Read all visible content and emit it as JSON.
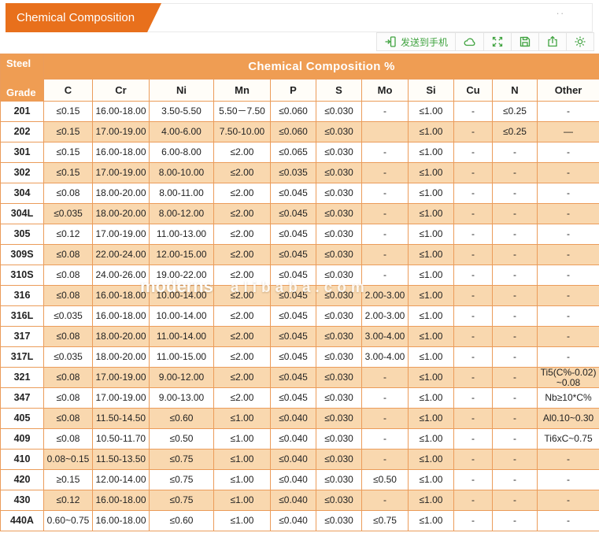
{
  "titlebar": {
    "tab_title": "Chemical Composition",
    "overflow_dots": ".."
  },
  "toolbar": {
    "send_to_phone_label": "发送到手机",
    "icons": [
      "send-to-phone",
      "cloud",
      "fullscreen",
      "save",
      "share",
      "settings"
    ]
  },
  "colors": {
    "tab_orange": "#e8701c",
    "header_orange": "#ef9d53",
    "row_peach": "#f9d8af",
    "border_orange": "#eb9c5a",
    "icon_green": "#3fa33f"
  },
  "watermark": {
    "brand": "moderns",
    "site": "alibaba.com"
  },
  "table": {
    "corner_top": "Steel",
    "corner_bottom": "Grade",
    "header_band": "Chemical Composition %",
    "columns": [
      "C",
      "Cr",
      "Ni",
      "Mn",
      "P",
      "S",
      "Mo",
      "Si",
      "Cu",
      "N",
      "Other"
    ],
    "rows": [
      {
        "grade": "201",
        "values": [
          "≤0.15",
          "16.00-18.00",
          "3.50-5.50",
          "5.50－7.50",
          "≤0.060",
          "≤0.030",
          "-",
          "≤1.00",
          "-",
          "≤0.25",
          "-"
        ]
      },
      {
        "grade": "202",
        "values": [
          "≤0.15",
          "17.00-19.00",
          "4.00-6.00",
          "7.50-10.00",
          "≤0.060",
          "≤0.030",
          "",
          "≤1.00",
          "-",
          "≤0.25",
          "—"
        ]
      },
      {
        "grade": "301",
        "values": [
          "≤0.15",
          "16.00-18.00",
          "6.00-8.00",
          "≤2.00",
          "≤0.065",
          "≤0.030",
          "-",
          "≤1.00",
          "-",
          "-",
          "-"
        ]
      },
      {
        "grade": "302",
        "values": [
          "≤0.15",
          "17.00-19.00",
          "8.00-10.00",
          "≤2.00",
          "≤0.035",
          "≤0.030",
          "-",
          "≤1.00",
          "-",
          "-",
          "-"
        ]
      },
      {
        "grade": "304",
        "values": [
          "≤0.08",
          "18.00-20.00",
          "8.00-11.00",
          "≤2.00",
          "≤0.045",
          "≤0.030",
          "-",
          "≤1.00",
          "-",
          "-",
          "-"
        ]
      },
      {
        "grade": "304L",
        "values": [
          "≤0.035",
          "18.00-20.00",
          "8.00-12.00",
          "≤2.00",
          "≤0.045",
          "≤0.030",
          "-",
          "≤1.00",
          "-",
          "-",
          "-"
        ]
      },
      {
        "grade": "305",
        "values": [
          "≤0.12",
          "17.00-19.00",
          "11.00-13.00",
          "≤2.00",
          "≤0.045",
          "≤0.030",
          "-",
          "≤1.00",
          "-",
          "-",
          "-"
        ]
      },
      {
        "grade": "309S",
        "values": [
          "≤0.08",
          "22.00-24.00",
          "12.00-15.00",
          "≤2.00",
          "≤0.045",
          "≤0.030",
          "-",
          "≤1.00",
          "-",
          "-",
          "-"
        ]
      },
      {
        "grade": "310S",
        "values": [
          "≤0.08",
          "24.00-26.00",
          "19.00-22.00",
          "≤2.00",
          "≤0.045",
          "≤0.030",
          "-",
          "≤1.00",
          "-",
          "-",
          "-"
        ]
      },
      {
        "grade": "316",
        "values": [
          "≤0.08",
          "16.00-18.00",
          "10.00-14.00",
          "≤2.00",
          "≤0.045",
          "≤0.030",
          "2.00-3.00",
          "≤1.00",
          "-",
          "-",
          "-"
        ]
      },
      {
        "grade": "316L",
        "values": [
          "≤0.035",
          "16.00-18.00",
          "10.00-14.00",
          "≤2.00",
          "≤0.045",
          "≤0.030",
          "2.00-3.00",
          "≤1.00",
          "-",
          "-",
          "-"
        ]
      },
      {
        "grade": "317",
        "values": [
          "≤0.08",
          "18.00-20.00",
          "11.00-14.00",
          "≤2.00",
          "≤0.045",
          "≤0.030",
          "3.00-4.00",
          "≤1.00",
          "-",
          "-",
          "-"
        ]
      },
      {
        "grade": "317L",
        "values": [
          "≤0.035",
          "18.00-20.00",
          "11.00-15.00",
          "≤2.00",
          "≤0.045",
          "≤0.030",
          "3.00-4.00",
          "≤1.00",
          "-",
          "-",
          "-"
        ]
      },
      {
        "grade": "321",
        "values": [
          "≤0.08",
          "17.00-19.00",
          "9.00-12.00",
          "≤2.00",
          "≤0.045",
          "≤0.030",
          "-",
          "≤1.00",
          "-",
          "-",
          "Ti5(C%-0.02) ~0.08"
        ]
      },
      {
        "grade": "347",
        "values": [
          "≤0.08",
          "17.00-19.00",
          "9.00-13.00",
          "≤2.00",
          "≤0.045",
          "≤0.030",
          "-",
          "≤1.00",
          "-",
          "-",
          "Nb≥10*C%"
        ]
      },
      {
        "grade": "405",
        "values": [
          "≤0.08",
          "11.50-14.50",
          "≤0.60",
          "≤1.00",
          "≤0.040",
          "≤0.030",
          "-",
          "≤1.00",
          "-",
          "-",
          "Al0.10~0.30"
        ]
      },
      {
        "grade": "409",
        "values": [
          "≤0.08",
          "10.50-11.70",
          "≤0.50",
          "≤1.00",
          "≤0.040",
          "≤0.030",
          "-",
          "≤1.00",
          "-",
          "-",
          "Ti6xC~0.75"
        ]
      },
      {
        "grade": "410",
        "values": [
          "0.08~0.15",
          "11.50-13.50",
          "≤0.75",
          "≤1.00",
          "≤0.040",
          "≤0.030",
          "-",
          "≤1.00",
          "-",
          "-",
          "-"
        ]
      },
      {
        "grade": "420",
        "values": [
          "≥0.15",
          "12.00-14.00",
          "≤0.75",
          "≤1.00",
          "≤0.040",
          "≤0.030",
          "≤0.50",
          "≤1.00",
          "-",
          "-",
          "-"
        ]
      },
      {
        "grade": "430",
        "values": [
          "≤0.12",
          "16.00-18.00",
          "≤0.75",
          "≤1.00",
          "≤0.040",
          "≤0.030",
          "-",
          "≤1.00",
          "-",
          "-",
          "-"
        ]
      },
      {
        "grade": "440A",
        "values": [
          "0.60~0.75",
          "16.00-18.00",
          "≤0.60",
          "≤1.00",
          "≤0.040",
          "≤0.030",
          "≤0.75",
          "≤1.00",
          "-",
          "-",
          "-"
        ]
      }
    ]
  }
}
